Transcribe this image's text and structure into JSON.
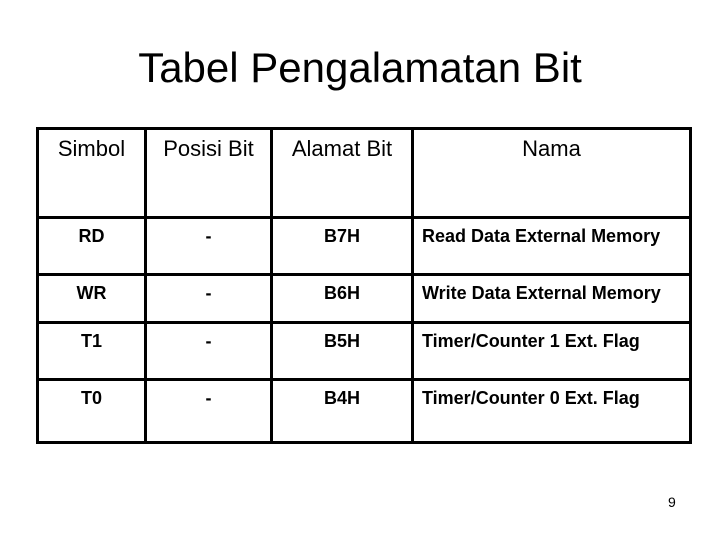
{
  "title": "Tabel Pengalamatan Bit",
  "table": {
    "headers": [
      "Simbol",
      "Posisi Bit",
      "Alamat Bit",
      "Nama"
    ],
    "rows": [
      [
        "RD",
        "-",
        "B7H",
        "Read Data External Memory"
      ],
      [
        "WR",
        "-",
        "B6H",
        "Write Data External Memory"
      ],
      [
        "T1",
        "-",
        "B5H",
        "Timer/Counter 1 Ext. Flag"
      ],
      [
        "T0",
        "-",
        "B4H",
        "Timer/Counter 0 Ext. Flag"
      ]
    ]
  },
  "page_number": "9"
}
